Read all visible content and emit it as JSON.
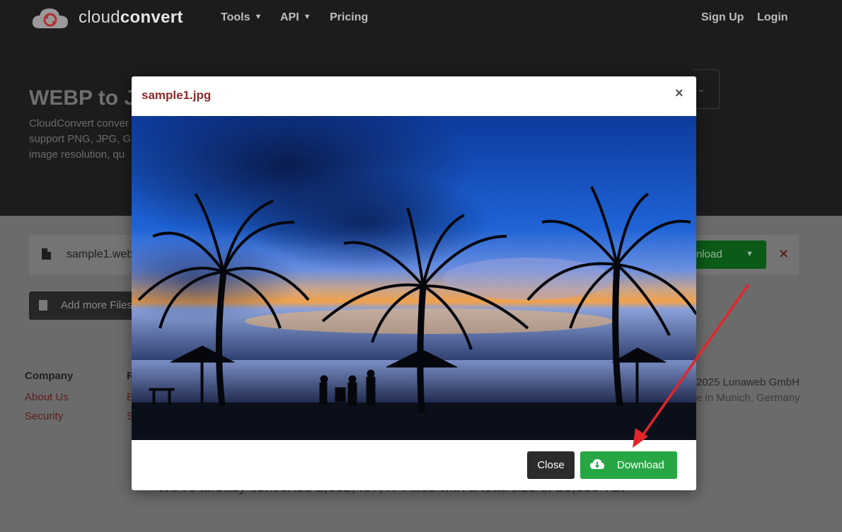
{
  "header": {
    "brand_light": "cloud",
    "brand_bold": "convert",
    "nav": [
      {
        "label": "Tools",
        "has_caret": true
      },
      {
        "label": "API",
        "has_caret": true
      },
      {
        "label": "Pricing",
        "has_caret": false
      }
    ],
    "sign_up": "Sign Up",
    "login": "Login"
  },
  "hero": {
    "title": "WEBP to J",
    "text_lines": [
      "CloudConvert conver",
      "support PNG, JPG, GI",
      "image resolution, qu"
    ]
  },
  "file": {
    "name": "sample1.web",
    "download_partial": "nload"
  },
  "add_files": {
    "label": "Add more Files"
  },
  "footer": {
    "company_heading": "Company",
    "company_links": [
      "About Us",
      "Security"
    ],
    "col2_heading": "R",
    "col2_links": [
      "E",
      "S"
    ],
    "copyright": "2025 Lunaweb GmbH",
    "made_in": "e in Munich, Germany",
    "stats": "We've already converted 2,552,487,474 files with a total size of 20,559 TB."
  },
  "modal": {
    "title": "sample1.jpg",
    "close_x": "×",
    "close_button": "Close",
    "download_button": "Download"
  },
  "colors": {
    "accent_green": "#27a744",
    "title_red": "#8b2a2a",
    "dark": "#1c1c1c"
  }
}
